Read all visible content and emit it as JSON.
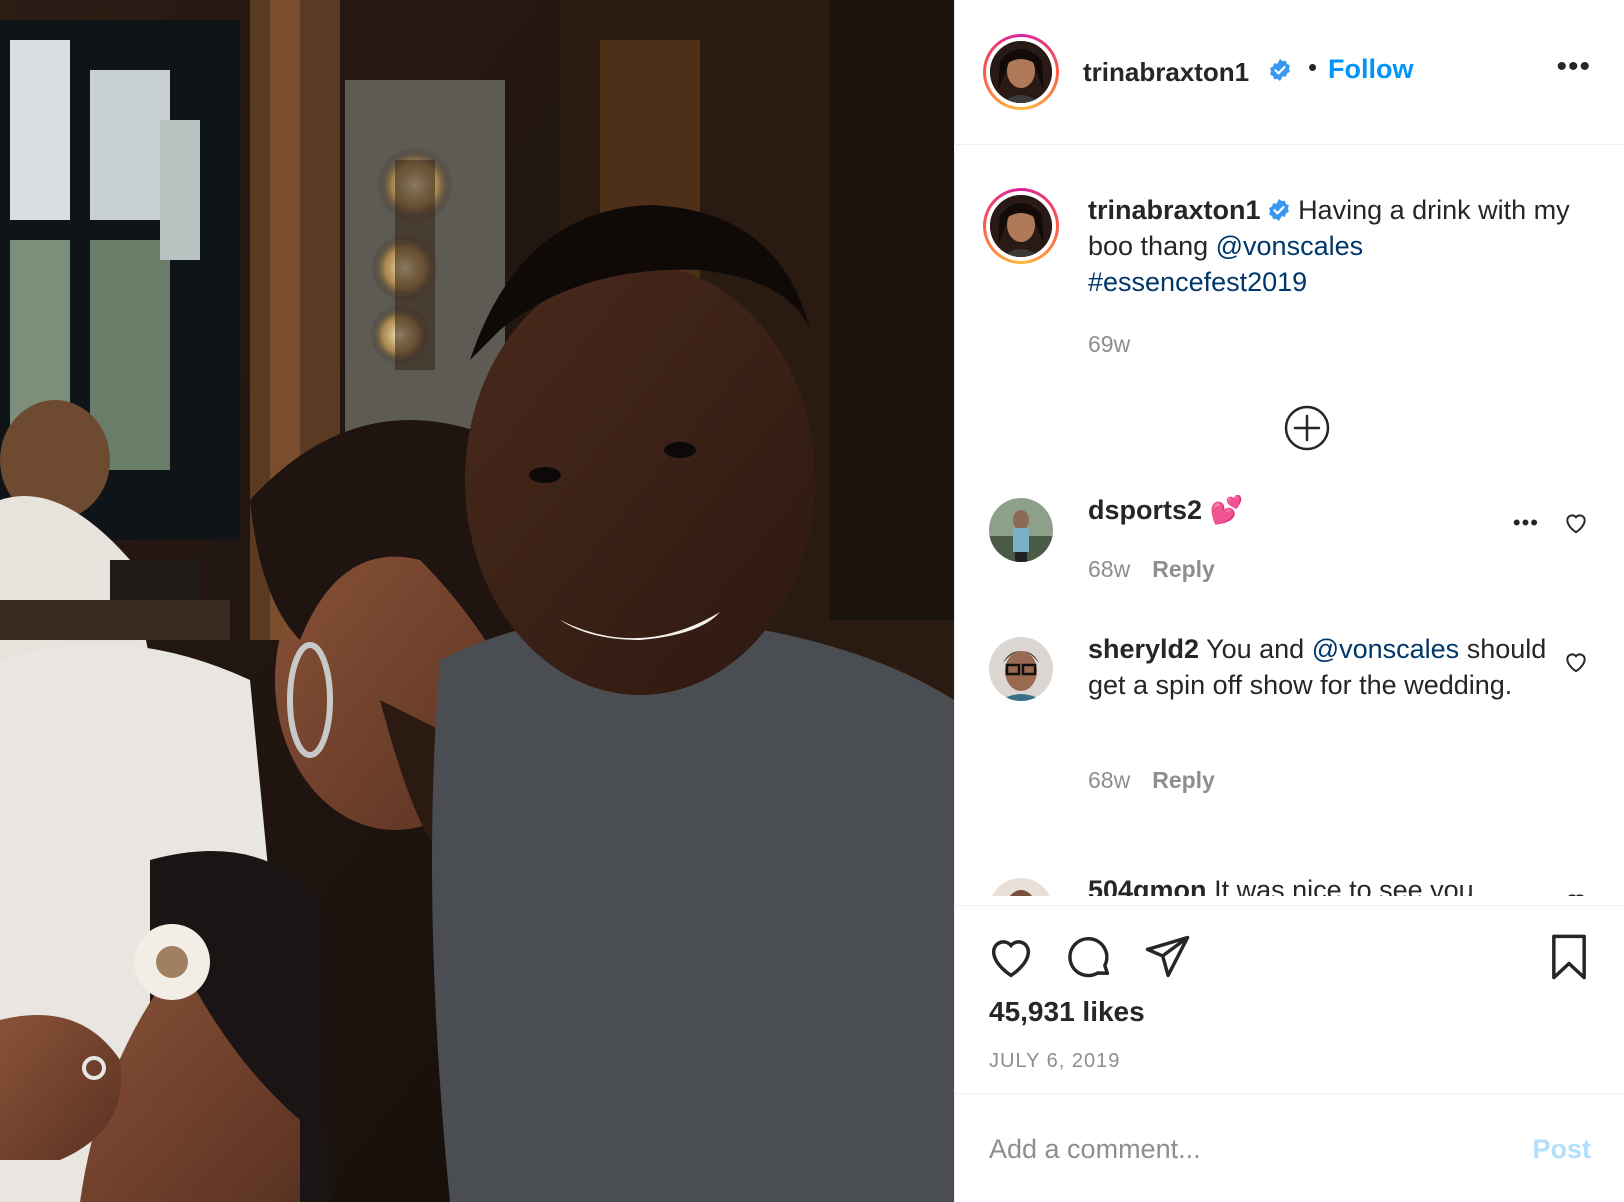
{
  "post": {
    "username": "trinabraxton1",
    "verified": true,
    "follow_label": "Follow",
    "separator": "•",
    "more_label": "•••"
  },
  "caption": {
    "username": "trinabraxton1",
    "text_before": "Having a drink with my boo thang ",
    "mention": "@vonscales",
    "hashtag": "#essencefest2019",
    "age": "69w"
  },
  "comments": [
    {
      "username": "dsports2",
      "text": "💕",
      "age": "68w",
      "reply_label": "Reply",
      "more_label": "•••"
    },
    {
      "username": "sheryld2",
      "text_before": "You and ",
      "mention": "@vonscales",
      "text_after": " should get a spin off show for the wedding.",
      "age": "68w",
      "reply_label": "Reply"
    },
    {
      "username": "504gmon",
      "text": "It was nice to see you"
    }
  ],
  "actions": {
    "likes": "45,931 likes",
    "date": "JULY 6, 2019"
  },
  "add_comment": {
    "placeholder": "Add a comment...",
    "post_label": "Post"
  },
  "colors": {
    "accent": "#0095f6",
    "link": "#00376b",
    "muted": "#8e8e8e",
    "post_disabled": "#b2dffc"
  },
  "icons": [
    "verified-badge-icon",
    "more-options-icon",
    "load-more-plus-icon",
    "heart-icon",
    "comment-bubble-icon",
    "share-paper-plane-icon",
    "bookmark-icon"
  ]
}
